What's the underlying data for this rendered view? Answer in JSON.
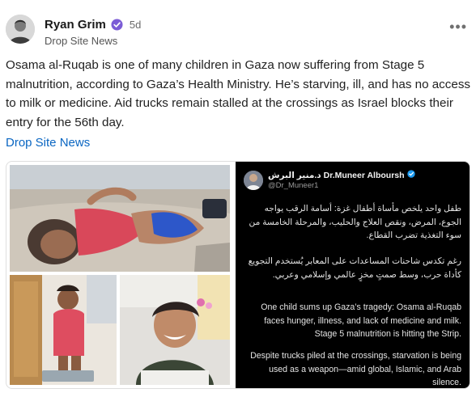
{
  "post": {
    "author": "Ryan Grim",
    "time": "5d",
    "subtitle": "Drop Site News",
    "more_icon": "more-horizontal-icon",
    "body": "Osama al-Ruqab is one of many children in Gaza now suffering from Stage 5 malnutrition, according to Gaza’s Health Ministry. He’s starving, ill, and has no access to milk or medicine. Aid trucks remain stalled at the crossings as Israel blocks their entry for the 56th day.",
    "link_text": "Drop Site News"
  },
  "embedded_tweet": {
    "name": "د.منير البرش Dr.Muneer Alboursh",
    "handle": "@Dr_Muneer1",
    "para1": "طفل واحد يلخص مأساة أطفال غزة: أسامة الرقب يواجه الجوع، المرض، ونقص العلاج والحليب، والمرحلة الخامسة من سوء التغذية تضرب القطاع.",
    "para2": "رغم تكدس شاحنات المساعدات على المعابر يُستخدم التجويع كأداة حرب، وسط صمتٍ مخزٍ عالمي وإسلامي وعربي.",
    "para3": "One child sums up Gaza’s tragedy: Osama al-Ruqab faces hunger, illness, and lack of medicine and milk. Stage 5 malnutrition is hitting the Strip.",
    "para4": "Despite trucks piled at the crossings, starvation is being used as a weapon—amid global, Islamic, and Arab silence."
  },
  "colors": {
    "link": "#0a66c2",
    "verified": "#7b5cd6",
    "tweet_bg": "#000000"
  }
}
